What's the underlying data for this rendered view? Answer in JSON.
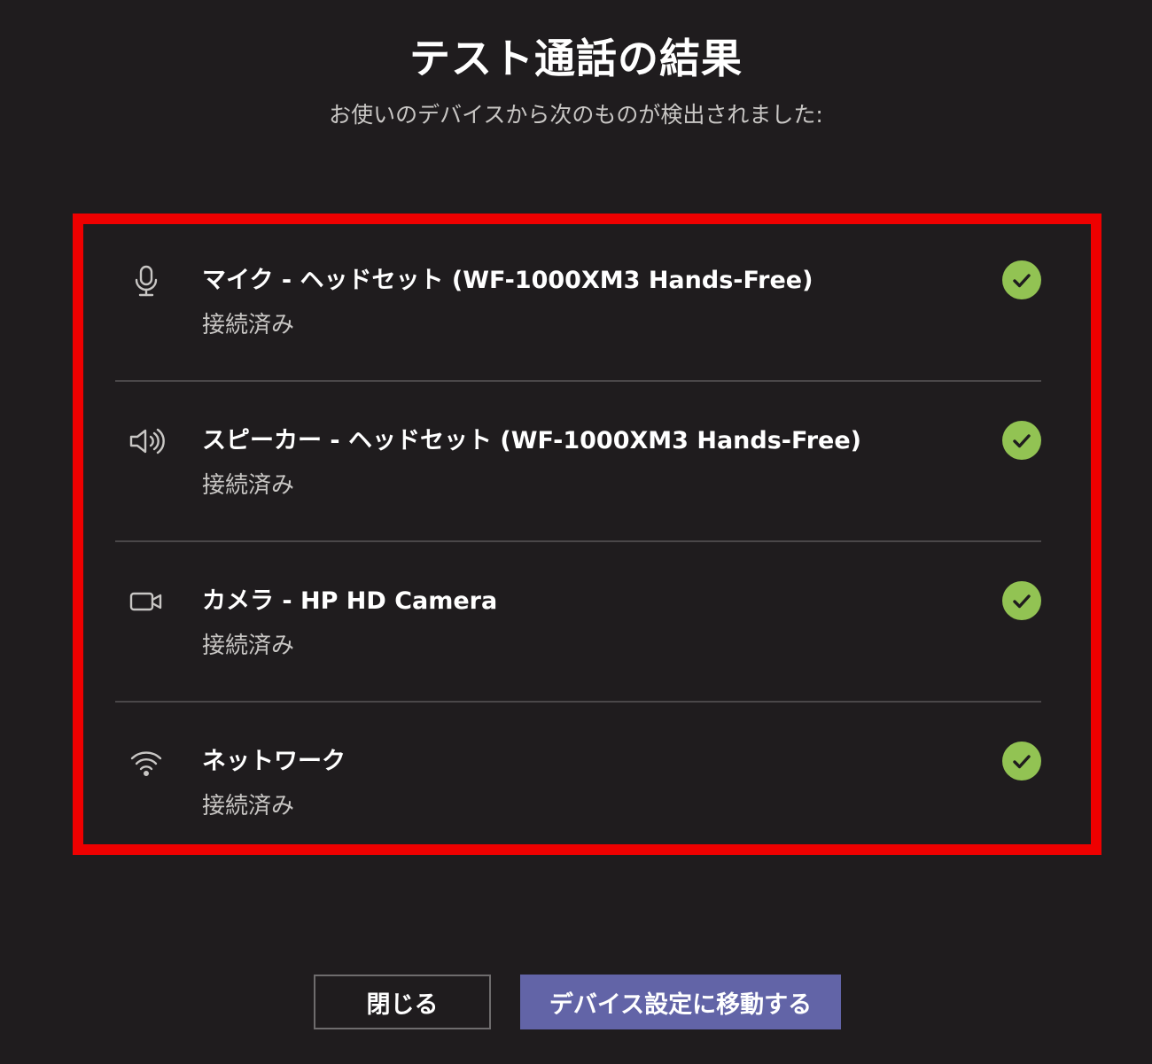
{
  "dialog": {
    "title": "テスト通話の結果",
    "subtitle": "お使いのデバイスから次のものが検出されました:"
  },
  "devices": [
    {
      "icon": "microphone-icon",
      "name": "マイク - ヘッドセット (WF-1000XM3 Hands-Free)",
      "status": "接続済み"
    },
    {
      "icon": "speaker-icon",
      "name": "スピーカー - ヘッドセット (WF-1000XM3 Hands-Free)",
      "status": "接続済み"
    },
    {
      "icon": "camera-icon",
      "name": "カメラ - HP HD Camera",
      "status": "接続済み"
    },
    {
      "icon": "wifi-icon",
      "name": "ネットワーク",
      "status": "接続済み"
    }
  ],
  "buttons": {
    "close_label": "閉じる",
    "device_settings_label": "デバイス設定に移動する"
  },
  "colors": {
    "background": "#1f1c1e",
    "highlight_border": "#ee0000",
    "check_green": "#92c353",
    "primary_button": "#6264a7"
  }
}
